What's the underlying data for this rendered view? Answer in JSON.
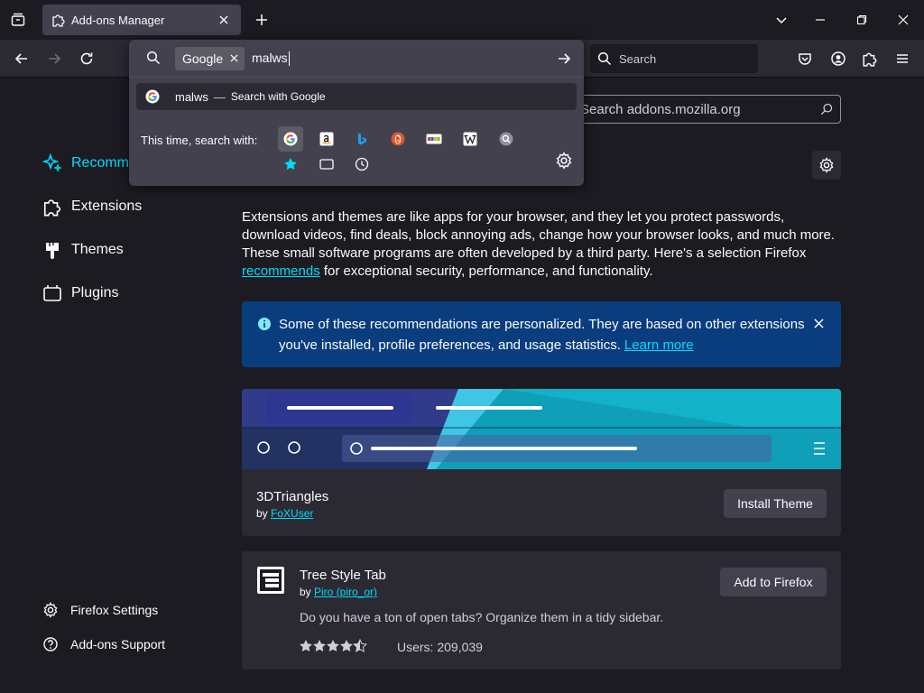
{
  "tab": {
    "title": "Add-ons Manager"
  },
  "navbar": {
    "search_placeholder": "Search"
  },
  "urlbar": {
    "engine_chip": "Google",
    "input_text": "malws",
    "result": {
      "query": "malws",
      "separator": "—",
      "action": "Search with Google"
    },
    "oneoff_label": "This time, search with:",
    "engines": [
      "Google",
      "Amazon",
      "Bing",
      "DuckDuckGo",
      "eBay",
      "Wikipedia",
      "Search"
    ],
    "modes": [
      "Bookmarks",
      "Tabs",
      "History"
    ]
  },
  "amo_search": {
    "placeholder": "Search addons.mozilla.org"
  },
  "sidebar": {
    "categories": [
      {
        "label": "Recommendations"
      },
      {
        "label": "Extensions"
      },
      {
        "label": "Themes"
      },
      {
        "label": "Plugins"
      }
    ],
    "footer": [
      {
        "label": "Firefox Settings"
      },
      {
        "label": "Add-ons Support"
      }
    ]
  },
  "intro": {
    "text_before": "Extensions and themes are like apps for your browser, and they let you protect passwords, download videos, find deals, block annoying ads, change how your browser looks, and much more. These small software programs are often developed by a third party. Here's a selection Firefox ",
    "link": "recommends",
    "text_after": " for exceptional security, performance, and functionality."
  },
  "notice": {
    "text": "Some of these recommendations are personalized. They are based on other extensions you've installed, profile preferences, and usage statistics.",
    "link": "Learn more"
  },
  "addons": [
    {
      "name": "3DTriangles",
      "by_prefix": "by ",
      "author": "FoXUser",
      "button": "Install Theme"
    },
    {
      "name": "Tree Style Tab",
      "by_prefix": "by ",
      "author": "Piro (piro_or)",
      "button": "Add to Firefox",
      "description": "Do you have a ton of open tabs? Organize them in a tidy sidebar.",
      "rating": 4.5,
      "users": "Users: 209,039"
    }
  ],
  "colors": {
    "accent": "#00ddff",
    "notice_bg": "#0a3d7e",
    "card_bg": "#2b2a33"
  }
}
